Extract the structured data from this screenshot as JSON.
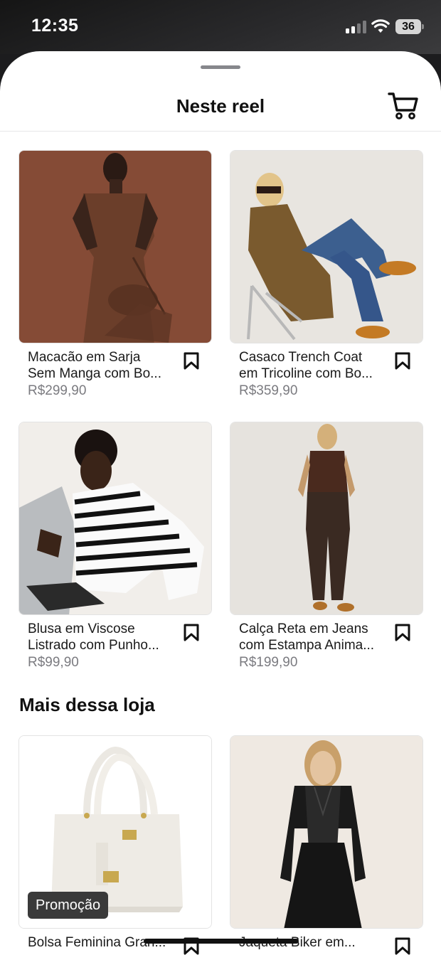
{
  "status_bar": {
    "time": "12:35",
    "battery": "36"
  },
  "sheet": {
    "title": "Neste reel"
  },
  "reel_products": [
    {
      "name_line1": "Macacão em Sarja",
      "name_line2": "Sem Manga com Bo...",
      "price": "R$299,90"
    },
    {
      "name_line1": "Casaco Trench Coat",
      "name_line2": "em Tricoline com Bo...",
      "price": "R$359,90"
    },
    {
      "name_line1": "Blusa em Viscose",
      "name_line2": "Listrado com Punho...",
      "price": "R$99,90"
    },
    {
      "name_line1": "Calça Reta em Jeans",
      "name_line2": "com Estampa Anima...",
      "price": "R$199,90"
    }
  ],
  "more_section": {
    "title": "Mais dessa loja"
  },
  "more_products": [
    {
      "name_line1": "Bolsa Feminina Gran...",
      "badge": "Promoção"
    },
    {
      "name_line1": "Jaqueta Biker em..."
    }
  ],
  "colors": {
    "accent_dark": "#111111",
    "price_gray": "#7b7b80",
    "badge_bg": "#3a3a3a"
  }
}
